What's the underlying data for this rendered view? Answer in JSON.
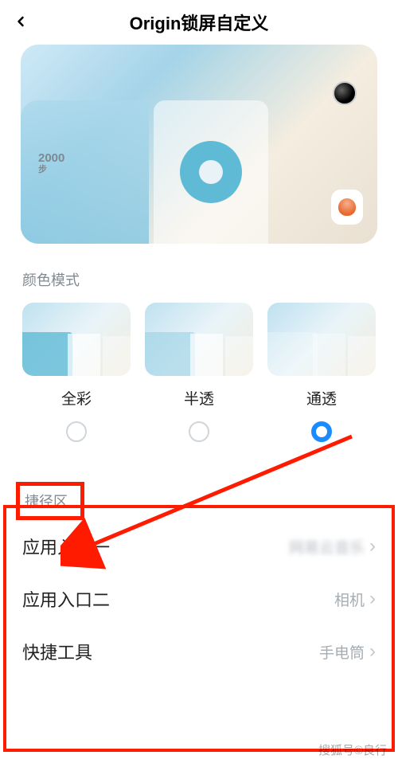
{
  "header": {
    "title": "Origin锁屏自定义"
  },
  "preview": {
    "steps_value": "2000",
    "steps_unit": "步"
  },
  "color_mode_section_label": "颜色模式",
  "color_modes": {
    "full": {
      "label": "全彩"
    },
    "half": {
      "label": "半透"
    },
    "clear": {
      "label": "通透"
    }
  },
  "shortcut": {
    "section_title": "捷径区",
    "items": {
      "entry1": {
        "label": "应用入口一",
        "value": "网易云音乐"
      },
      "entry2": {
        "label": "应用入口二",
        "value": "相机"
      },
      "tool": {
        "label": "快捷工具",
        "value": "手电筒"
      }
    }
  },
  "watermark": "搜狐号©良行"
}
